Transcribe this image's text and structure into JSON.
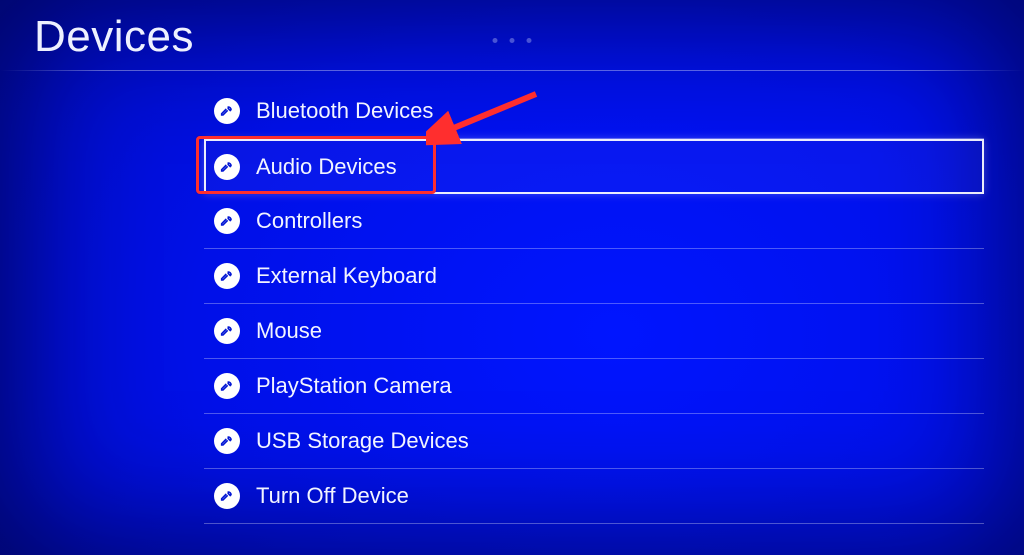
{
  "title": "Devices",
  "menu": {
    "items": [
      {
        "label": "Bluetooth Devices",
        "selected": false
      },
      {
        "label": "Audio Devices",
        "selected": true
      },
      {
        "label": "Controllers",
        "selected": false
      },
      {
        "label": "External Keyboard",
        "selected": false
      },
      {
        "label": "Mouse",
        "selected": false
      },
      {
        "label": "PlayStation Camera",
        "selected": false
      },
      {
        "label": "USB Storage Devices",
        "selected": false
      },
      {
        "label": "Turn Off Device",
        "selected": false
      }
    ]
  },
  "annotation": {
    "highlight_index": 1,
    "highlight_color": "#ff2e2e",
    "arrow_color": "#ff2e2e"
  }
}
